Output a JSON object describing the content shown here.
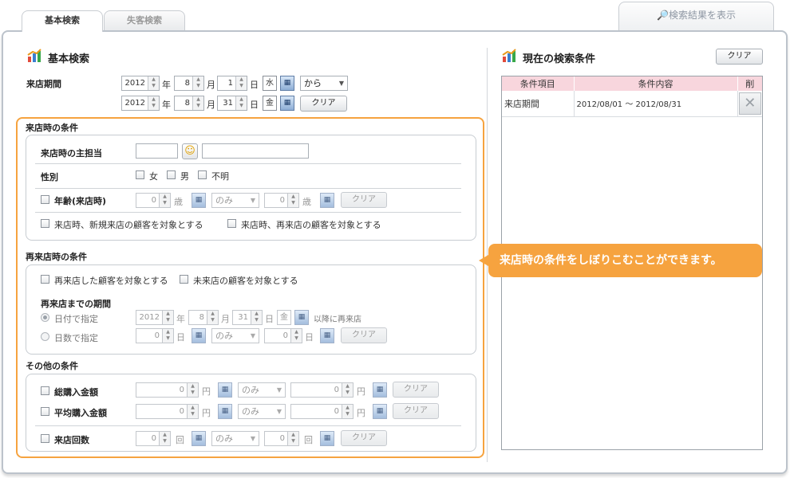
{
  "tabs": [
    {
      "label": "基本検索",
      "active": true
    },
    {
      "label": "失客検索",
      "active": false
    }
  ],
  "show_results_label": "🔎検索結果を表示",
  "left_title": "基本検索",
  "period": {
    "label": "来店期間",
    "from": {
      "year": "2012",
      "month": "8",
      "day": "1",
      "dow": "水"
    },
    "to": {
      "year": "2012",
      "month": "8",
      "day": "31",
      "dow": "金"
    },
    "range_select": "から",
    "clear": "クリア"
  },
  "units": {
    "year": "年",
    "month": "月",
    "day": "日",
    "age": "歳",
    "yen": "円",
    "times": "回"
  },
  "visit_section": {
    "title": "来店時の条件",
    "staff_label": "来店時の主担当",
    "gender_label": "性別",
    "genders": [
      "女",
      "男",
      "不明"
    ],
    "age_label": "年齢(来店時)",
    "age_from": "0",
    "age_to": "0",
    "age_select": "のみ",
    "clear": "クリア",
    "new_visit": "来店時、新規来店の顧客を対象とする",
    "repeat_visit": "来店時、再来店の顧客を対象とする"
  },
  "revisit_section": {
    "title": "再来店時の条件",
    "revisited": "再来店した顧客を対象とする",
    "not_revisited": "未来店の顧客を対象とする",
    "period_title": "再来店までの期間",
    "by_date": "日付で指定",
    "by_days": "日数で指定",
    "date": {
      "year": "2012",
      "month": "8",
      "day": "31",
      "dow": "金"
    },
    "after_text": "以降に再来店",
    "days_from": "0",
    "days_to": "0",
    "days_select": "のみ",
    "clear": "クリア"
  },
  "other_section": {
    "title": "その他の条件",
    "rows": [
      {
        "label": "総購入金額",
        "from": "0",
        "to": "0",
        "select": "のみ",
        "clear": "クリア"
      },
      {
        "label": "平均購入金額",
        "from": "0",
        "to": "0",
        "select": "のみ",
        "clear": "クリア"
      },
      {
        "label": "来店回数",
        "from": "0",
        "to": "0",
        "select": "のみ",
        "clear": "クリア"
      }
    ]
  },
  "right_title": "現在の検索条件",
  "right_clear": "クリア",
  "conditions_table": {
    "headers": [
      "条件項目",
      "条件内容",
      "削"
    ],
    "rows": [
      {
        "item": "来店期間",
        "content": "2012/08/01 〜 2012/08/31"
      }
    ]
  },
  "tooltip": "来店時の条件をしぼりこむことができます。",
  "colors": {
    "accent": "#f6a33f",
    "table_header": "#f8d6dd",
    "frame": "#bcc3cb"
  }
}
